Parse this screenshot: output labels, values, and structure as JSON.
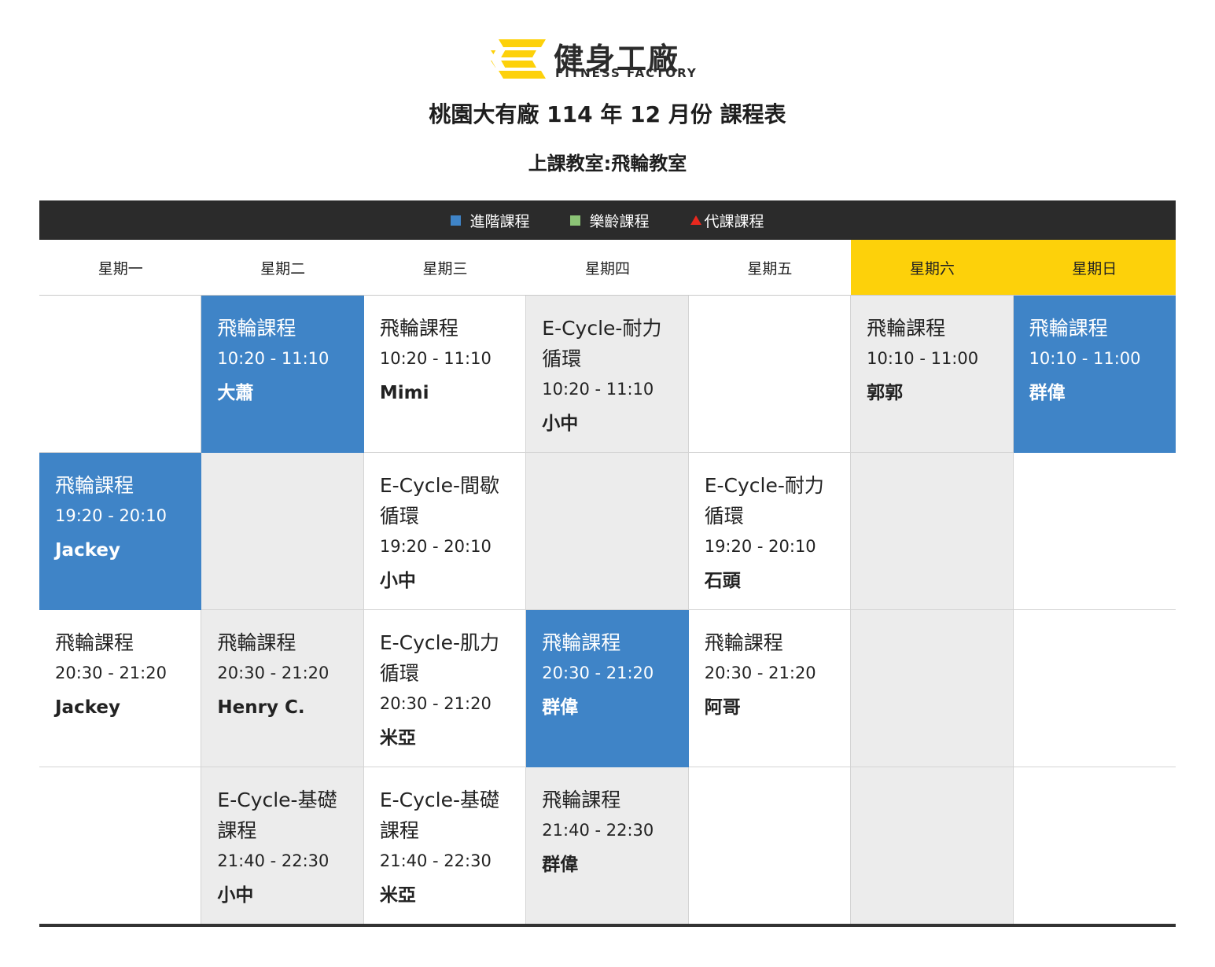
{
  "brand": {
    "name_cn": "健身工廠",
    "name_en": "FITNESS FACTORY"
  },
  "title": "桃園大有廠 114 年 12 月份 課程表",
  "subtitle": "上課教室:飛輪教室",
  "legend": [
    {
      "label": "進階課程",
      "color": "#3f84c7",
      "type": "square"
    },
    {
      "label": "樂齡課程",
      "color": "#8cc476",
      "type": "square"
    },
    {
      "label": "代課課程",
      "color": "#e8281e",
      "type": "triangle"
    }
  ],
  "days": [
    "星期一",
    "星期二",
    "星期三",
    "星期四",
    "星期五",
    "星期六",
    "星期日"
  ],
  "colors": {
    "weekend_header": "#fdd10a",
    "advanced": "#3f84c7",
    "gray_cell": "#ececec",
    "legend_bar": "#2b2b2b"
  },
  "rows": [
    [
      {
        "style": "white"
      },
      {
        "style": "blue",
        "name": "飛輪課程",
        "time": "10:20 - 11:10",
        "teacher": "大蕭"
      },
      {
        "style": "white",
        "name": "飛輪課程",
        "time": "10:20 - 11:10",
        "teacher": "Mimi"
      },
      {
        "style": "gray",
        "name": "E-Cycle-耐力循環",
        "time": "10:20 - 11:10",
        "teacher": "小中"
      },
      {
        "style": "white"
      },
      {
        "style": "gray",
        "name": "飛輪課程",
        "time": "10:10 - 11:00",
        "teacher": "郭郭"
      },
      {
        "style": "blue",
        "name": "飛輪課程",
        "time": "10:10 - 11:00",
        "teacher": "群偉"
      }
    ],
    [
      {
        "style": "blue",
        "name": "飛輪課程",
        "time": "19:20 - 20:10",
        "teacher": "Jackey"
      },
      {
        "style": "gray"
      },
      {
        "style": "white",
        "name": "E-Cycle-間歇循環",
        "time": "19:20 - 20:10",
        "teacher": "小中"
      },
      {
        "style": "gray"
      },
      {
        "style": "white",
        "name": "E-Cycle-耐力循環",
        "time": "19:20 - 20:10",
        "teacher": "石頭"
      },
      {
        "style": "gray"
      },
      {
        "style": "white"
      }
    ],
    [
      {
        "style": "white",
        "name": "飛輪課程",
        "time": "20:30 - 21:20",
        "teacher": "Jackey"
      },
      {
        "style": "gray",
        "name": "飛輪課程",
        "time": "20:30 - 21:20",
        "teacher": "Henry C."
      },
      {
        "style": "white",
        "name": "E-Cycle-肌力循環",
        "time": "20:30 - 21:20",
        "teacher": "米亞"
      },
      {
        "style": "blue",
        "name": "飛輪課程",
        "time": "20:30 - 21:20",
        "teacher": "群偉"
      },
      {
        "style": "white",
        "name": "飛輪課程",
        "time": "20:30 - 21:20",
        "teacher": "阿哥"
      },
      {
        "style": "gray"
      },
      {
        "style": "white"
      }
    ],
    [
      {
        "style": "white"
      },
      {
        "style": "gray",
        "name": "E-Cycle-基礎課程",
        "time": "21:40 - 22:30",
        "teacher": "小中"
      },
      {
        "style": "white",
        "name": "E-Cycle-基礎課程",
        "time": "21:40 - 22:30",
        "teacher": "米亞"
      },
      {
        "style": "gray",
        "name": "飛輪課程",
        "time": "21:40 - 22:30",
        "teacher": "群偉"
      },
      {
        "style": "white"
      },
      {
        "style": "gray"
      },
      {
        "style": "white"
      }
    ]
  ]
}
